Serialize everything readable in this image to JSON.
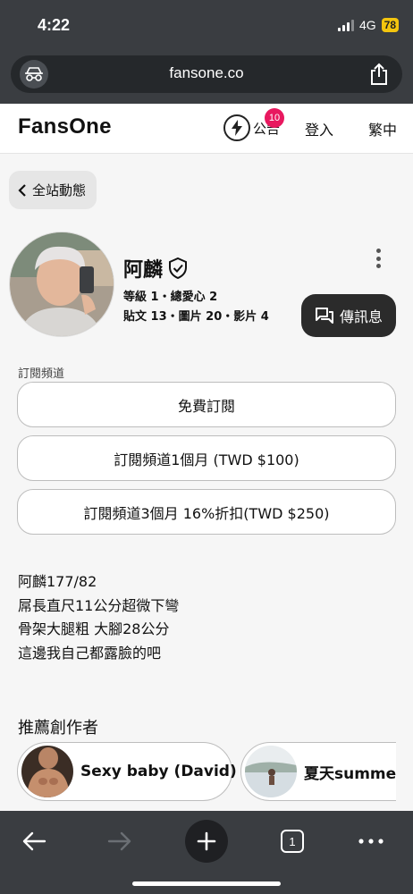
{
  "status_bar": {
    "time": "4:22",
    "network": "4G",
    "battery": "78"
  },
  "browser": {
    "url": "fansone.co",
    "open_tabs": "1"
  },
  "header": {
    "logo": "FansOne",
    "announcement_label": "公告",
    "announcement_count": "10",
    "login_label": "登入",
    "language_label": "繁中"
  },
  "back_button": {
    "label": "全站動態"
  },
  "profile": {
    "name": "阿麟",
    "stats_line1": "等級 1・總愛心 2",
    "stats_line2": "貼文 13・圖片 20・影片 4",
    "message_button": "傳訊息"
  },
  "subscription": {
    "title": "訂閱頻道",
    "options": [
      "免費訂閱",
      "訂閱頻道1個月 (TWD $100)",
      "訂閱頻道3個月 16%折扣(TWD $250)"
    ]
  },
  "bio": [
    "阿麟177/82",
    "屌長直尺11公分超微下彎",
    "骨架大腿粗 大腳28公分",
    "這邊我自己都露臉的吧"
  ],
  "recommended": {
    "title": "推薦創作者",
    "creators": [
      {
        "name": "Sexy baby (David)"
      },
      {
        "name": "夏天summer"
      }
    ]
  },
  "colors": {
    "browser_chrome": "#3a3d41",
    "badge": "#e8185f",
    "battery": "#f3c50e",
    "message_button": "#2b2b2b"
  },
  "icons": [
    "incognito-icon",
    "share-icon",
    "bolt-icon",
    "chevron-left-icon",
    "verified-shield-icon",
    "more-vertical-icon",
    "chat-icon",
    "back-arrow-icon",
    "forward-arrow-icon",
    "plus-icon",
    "tabs-icon",
    "menu-dots-icon"
  ]
}
